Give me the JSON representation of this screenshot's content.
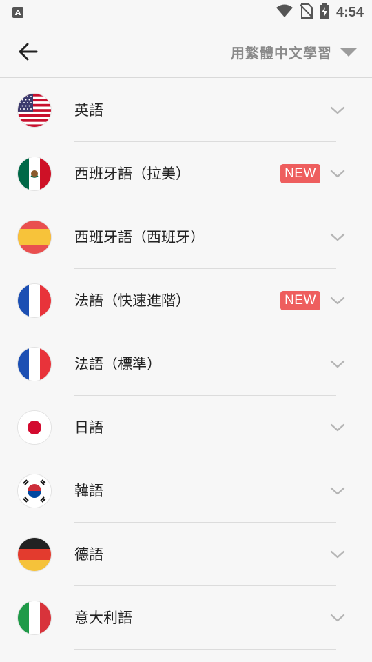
{
  "status_bar": {
    "time": "4:54",
    "app_icon_letter": "A",
    "icons": [
      "wifi-icon",
      "no-sim-icon",
      "battery-charging-icon"
    ]
  },
  "header": {
    "back_icon": "arrow-left-icon",
    "learn_language_label": "用繁體中文學習",
    "dropdown_icon": "triangle-down-icon"
  },
  "languages": [
    {
      "label": "英語",
      "flag": "us-flag-icon",
      "new": ""
    },
    {
      "label": "西班牙語（拉美）",
      "flag": "mexico-flag-icon",
      "new": "NEW"
    },
    {
      "label": "西班牙語（西班牙）",
      "flag": "spain-flag-icon",
      "new": ""
    },
    {
      "label": "法語（快速進階）",
      "flag": "france-flag-icon",
      "new": "NEW"
    },
    {
      "label": "法語（標準）",
      "flag": "france-flag-icon",
      "new": ""
    },
    {
      "label": "日語",
      "flag": "japan-flag-icon",
      "new": ""
    },
    {
      "label": "韓語",
      "flag": "korea-flag-icon",
      "new": ""
    },
    {
      "label": "德語",
      "flag": "germany-flag-icon",
      "new": ""
    },
    {
      "label": "意大利語",
      "flag": "italy-flag-icon",
      "new": ""
    }
  ],
  "colors": {
    "badge": "#ee5e5e",
    "background": "#f7f7f7",
    "chevron": "#b5b5b5",
    "header_label": "#8a8a8a"
  }
}
